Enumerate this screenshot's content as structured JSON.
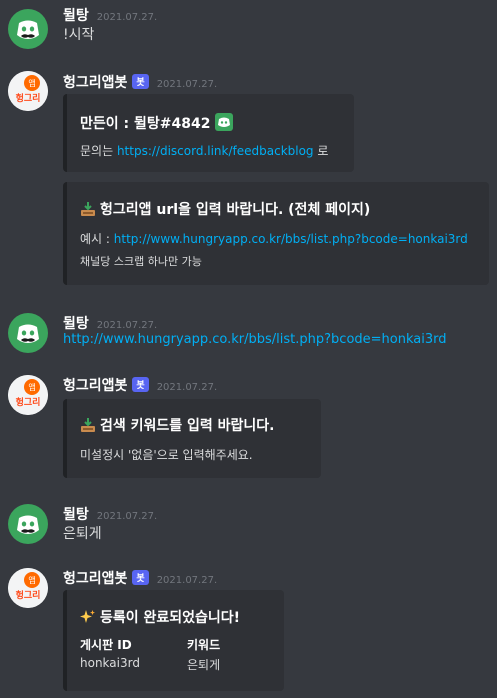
{
  "colors": {
    "background": "#36393f",
    "embed": "#2f3136",
    "link": "#00aff4",
    "bot_badge": "#5865f2",
    "discord_green": "#3ba55d"
  },
  "messages": [
    {
      "username": "뒬탕",
      "timestamp": "2021.07.27.",
      "text": "!시작",
      "avatar": "discord-avatar-icon"
    },
    {
      "username": "헝그리앱봇",
      "bot_tag": "봇",
      "timestamp": "2021.07.27.",
      "avatar": "hungryapp-avatar-icon",
      "embeds": [
        {
          "title": "만든이 : 뒬탕#4842",
          "desc_prefix": "문의는 ",
          "desc_link": "https://discord.link/feedbackblog",
          "desc_suffix": " 로",
          "icon": "discord-logo-icon"
        },
        {
          "title": "헝그리앱 url을 입력 바랍니다. (전체 페이지)",
          "line1_prefix": "예시 : ",
          "line1_link": "http://www.hungryapp.co.kr/bbs/list.php?bcode=honkai3rd",
          "line2": "채널당 스크랩 하나만 가능",
          "icon": "inbox-tray-icon"
        }
      ]
    },
    {
      "username": "뒬탕",
      "timestamp": "2021.07.27.",
      "text": "http://www.hungryapp.co.kr/bbs/list.php?bcode=honkai3rd",
      "avatar": "discord-avatar-icon"
    },
    {
      "username": "헝그리앱봇",
      "bot_tag": "봇",
      "timestamp": "2021.07.27.",
      "avatar": "hungryapp-avatar-icon",
      "embeds": [
        {
          "title": "검색 키워드를 입력 바랍니다.",
          "desc": "미설정시 '없음'으로 입력해주세요.",
          "icon": "inbox-tray-icon"
        }
      ]
    },
    {
      "username": "뒬탕",
      "timestamp": "2021.07.27.",
      "text": "은퇴게",
      "avatar": "discord-avatar-icon"
    },
    {
      "username": "헝그리앱봇",
      "bot_tag": "봇",
      "timestamp": "2021.07.27.",
      "avatar": "hungryapp-avatar-icon",
      "embeds": [
        {
          "title": "등록이 완료되었습니다!",
          "icon": "sparkles-icon",
          "fields": [
            {
              "name": "게시판 ID",
              "value": "honkai3rd"
            },
            {
              "name": "키워드",
              "value": "은퇴게"
            }
          ]
        }
      ]
    }
  ],
  "hungry_avatar_text": {
    "top": "앱",
    "bottom": "헝그리"
  }
}
